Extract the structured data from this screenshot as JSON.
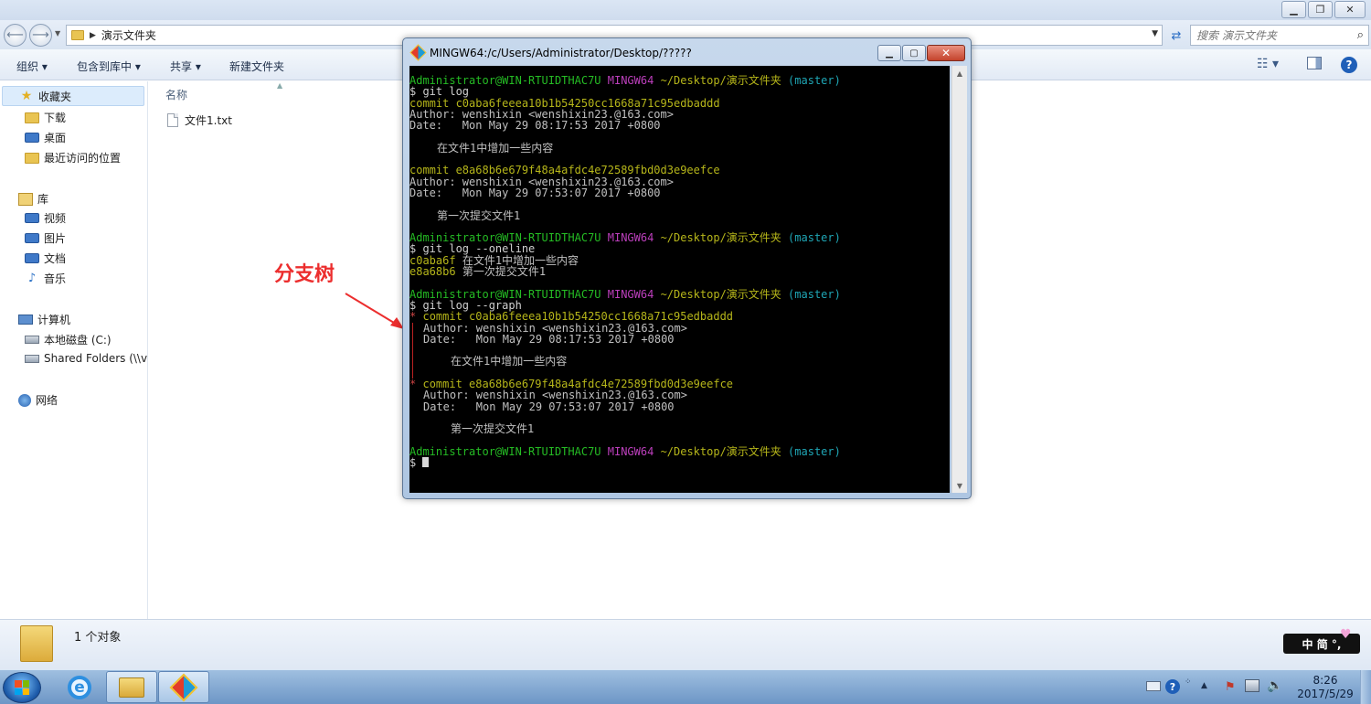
{
  "explorer": {
    "address_path": "演示文件夹",
    "search_placeholder": "搜索 演示文件夹",
    "toolbar": {
      "organize": "组织 ▾",
      "include_library": "包含到库中 ▾",
      "share": "共享 ▾",
      "new_folder": "新建文件夹"
    },
    "nav": {
      "favorites": "收藏夹",
      "downloads": "下载",
      "desktop": "桌面",
      "recent": "最近访问的位置",
      "libraries": "库",
      "videos": "视频",
      "pictures": "图片",
      "documents": "文档",
      "music": "音乐",
      "computer": "计算机",
      "local_disk": "本地磁盘 (C:)",
      "shared_folders": "Shared Folders (\\\\v",
      "network": "网络"
    },
    "column_name": "名称",
    "files": [
      "文件1.txt"
    ],
    "status_text": "1 个对象"
  },
  "annotation": {
    "label": "分支树"
  },
  "terminal_window": {
    "title": "MINGW64:/c/Users/Administrator/Desktop/?????",
    "prompt": {
      "user": "Administrator@WIN-RTUIDTHAC7U",
      "env": "MINGW64",
      "path": "~/Desktop/演示文件夹",
      "branch": "(master)"
    },
    "cmd_log": "$ git log",
    "cmd_oneline": "$ git log --oneline",
    "cmd_graph": "$ git log --graph",
    "commit1": {
      "line": "commit c0aba6feeea10b1b54250cc1668a71c95edbaddd",
      "author": "Author: wenshixin <wenshixin23.@163.com>",
      "date": "Date:   Mon May 29 08:17:53 2017 +0800",
      "message": "在文件1中增加一些内容"
    },
    "commit2": {
      "line": "commit e8a68b6e679f48a4afdc4e72589fbd0d3e9eefce",
      "author": "Author: wenshixin <wenshixin23.@163.com>",
      "date": "Date:   Mon May 29 07:53:07 2017 +0800",
      "message": "第一次提交文件1"
    },
    "oneline1_hash": "c0aba6f",
    "oneline1_msg": "在文件1中增加一些内容",
    "oneline2_hash": "e8a68b6",
    "oneline2_msg": "第一次提交文件1",
    "graph_star": "*",
    "final_prompt": "$"
  },
  "ime": {
    "label": "中 简 °,"
  },
  "taskbar": {
    "time": "8:26",
    "date": "2017/5/29"
  },
  "colors": {
    "prompt_green": "#25bc24",
    "prompt_magenta": "#bc3fbc",
    "commit_yellow": "#b6b61a",
    "branch_cyan": "#1fa6b5",
    "annotation_red": "#ec2e2e"
  }
}
